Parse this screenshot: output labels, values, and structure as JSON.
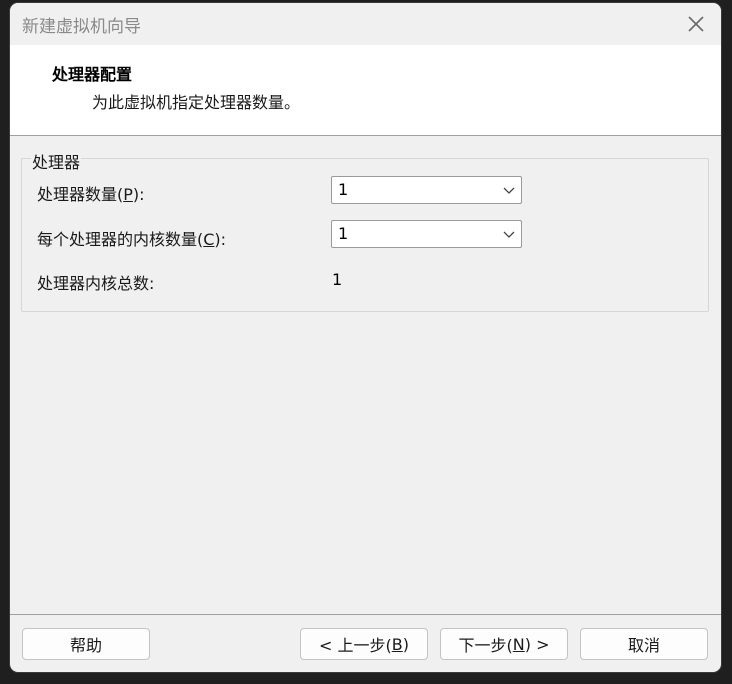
{
  "window": {
    "title": "新建虚拟机向导"
  },
  "header": {
    "title": "处理器配置",
    "description": "为此虚拟机指定处理器数量。"
  },
  "processor_group": {
    "legend": "处理器",
    "processor_count": {
      "label_prefix": "处理器数量(",
      "mnemonic": "P",
      "label_suffix": "):",
      "value": "1"
    },
    "cores_per_processor": {
      "label_prefix": "每个处理器的内核数量(",
      "mnemonic": "C",
      "label_suffix": "):",
      "value": "1"
    },
    "total_cores": {
      "label": "处理器内核总数:",
      "value": "1"
    }
  },
  "footer": {
    "help_label": "帮助",
    "back": {
      "prefix": "< 上一步(",
      "mnemonic": "B",
      "suffix": ")"
    },
    "next": {
      "prefix": "下一步(",
      "mnemonic": "N",
      "suffix": ") >"
    },
    "cancel_label": "取消"
  },
  "icons": {
    "close": "close-icon",
    "dropdown": "chevron-down-icon"
  },
  "colors": {
    "window_bg": "#f0f0f0",
    "header_bg": "#ffffff",
    "title_text": "#8a8a8a"
  }
}
